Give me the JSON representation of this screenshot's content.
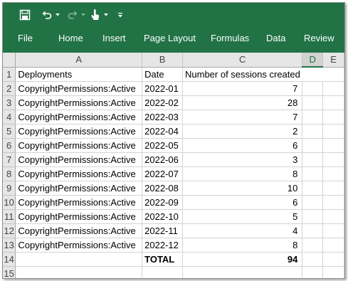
{
  "colors": {
    "ribbon": "#217346",
    "accent": "#217346"
  },
  "quick_access": {
    "save_icon": "save-icon",
    "undo_icon": "undo-icon",
    "redo_icon": "redo-icon",
    "touch_mode_icon": "touch-mode-icon",
    "customize_icon": "customize-qat-icon"
  },
  "ribbon": {
    "tabs": [
      {
        "label": "File"
      },
      {
        "label": "Home"
      },
      {
        "label": "Insert"
      },
      {
        "label": "Page Layout"
      },
      {
        "label": "Formulas"
      },
      {
        "label": "Data"
      },
      {
        "label": "Review"
      }
    ]
  },
  "sheet": {
    "active_column": "D",
    "columns": [
      "A",
      "B",
      "C",
      "D",
      "E"
    ],
    "rows": [
      {
        "num": "1",
        "a": "Deployments",
        "b": "Date",
        "c": "Number of sessions created"
      },
      {
        "num": "2",
        "a": "CopyrightPermissions:Active",
        "b": "2022-01",
        "c": "7"
      },
      {
        "num": "3",
        "a": "CopyrightPermissions:Active",
        "b": "2022-02",
        "c": "28"
      },
      {
        "num": "4",
        "a": "CopyrightPermissions:Active",
        "b": "2022-03",
        "c": "7"
      },
      {
        "num": "5",
        "a": "CopyrightPermissions:Active",
        "b": "2022-04",
        "c": "2"
      },
      {
        "num": "6",
        "a": "CopyrightPermissions:Active",
        "b": "2022-05",
        "c": "6"
      },
      {
        "num": "7",
        "a": "CopyrightPermissions:Active",
        "b": "2022-06",
        "c": "3"
      },
      {
        "num": "8",
        "a": "CopyrightPermissions:Active",
        "b": "2022-07",
        "c": "8"
      },
      {
        "num": "9",
        "a": "CopyrightPermissions:Active",
        "b": "2022-08",
        "c": "10"
      },
      {
        "num": "10",
        "a": "CopyrightPermissions:Active",
        "b": "2022-09",
        "c": "6"
      },
      {
        "num": "11",
        "a": "CopyrightPermissions:Active",
        "b": "2022-10",
        "c": "5"
      },
      {
        "num": "12",
        "a": "CopyrightPermissions:Active",
        "b": "2022-11",
        "c": "4"
      },
      {
        "num": "13",
        "a": "CopyrightPermissions:Active",
        "b": "2022-12",
        "c": "8"
      },
      {
        "num": "14",
        "a": "",
        "b": "TOTAL",
        "c": "94"
      },
      {
        "num": "15",
        "a": "",
        "b": "",
        "c": ""
      }
    ]
  }
}
